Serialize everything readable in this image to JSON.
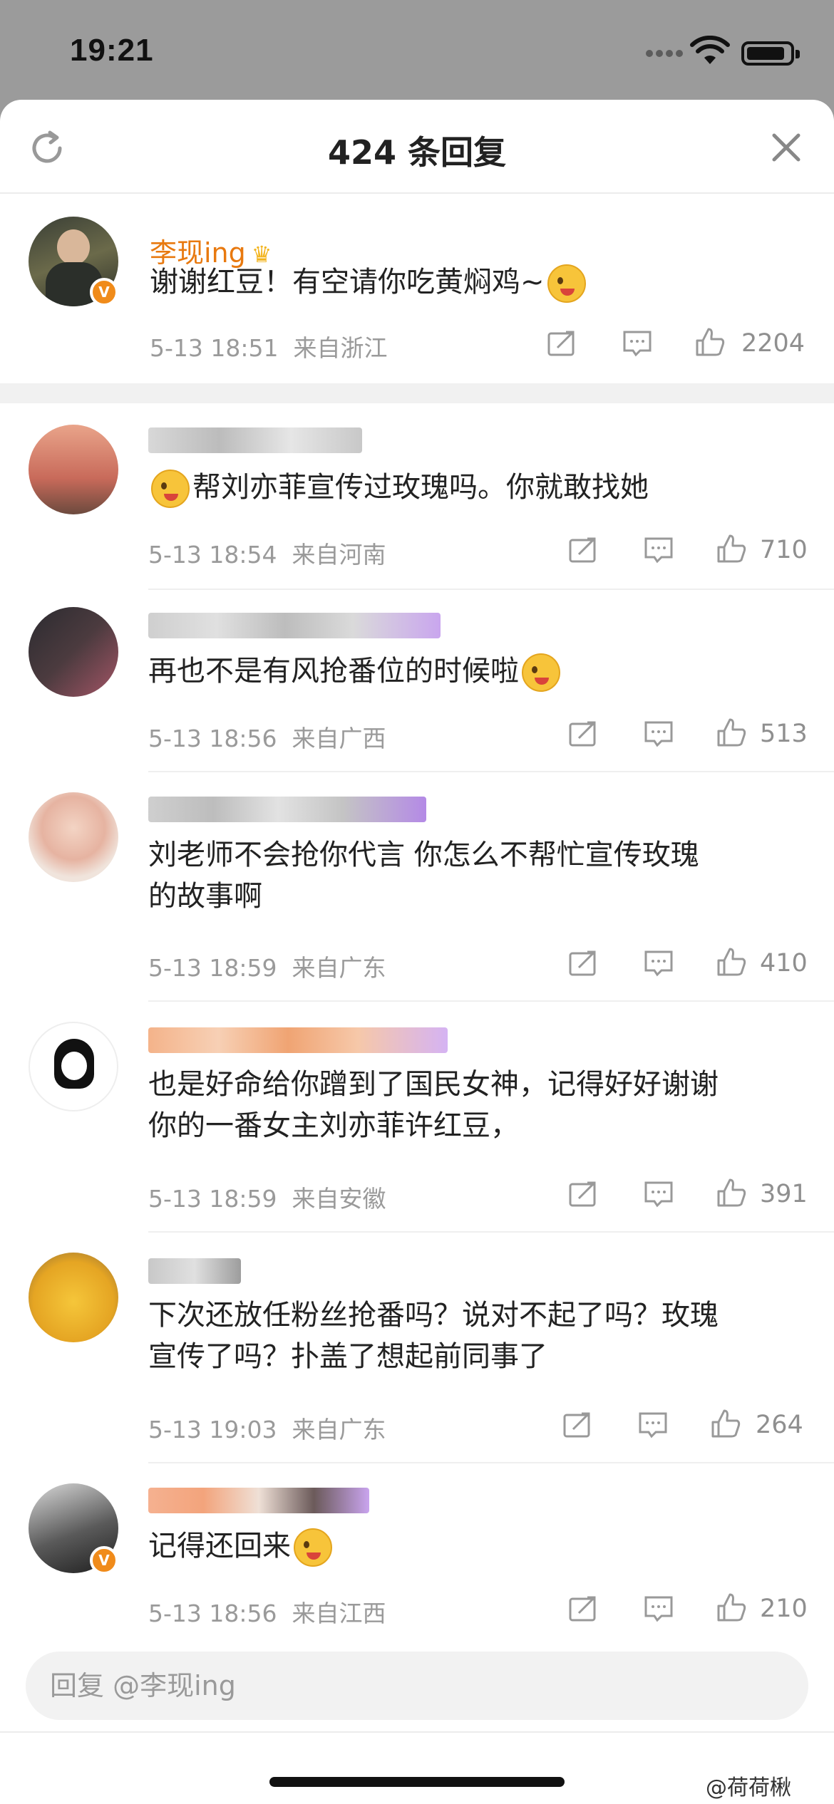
{
  "status_bar": {
    "time": "19:21"
  },
  "header": {
    "title": "424 条回复",
    "refresh_icon": "refresh-icon",
    "close_icon": "close-icon"
  },
  "top_comment": {
    "username": "李现ing",
    "badge": "crown",
    "text": "谢谢红豆！有空请你吃黄焖鸡~",
    "time": "5-13 18:51",
    "location": "来自浙江",
    "likes": "2204",
    "verified_badge": "V"
  },
  "replies": [
    {
      "text": "帮刘亦菲宣传过玫瑰吗。你就敢找她",
      "time": "5-13 18:54",
      "location": "来自河南",
      "likes": "710",
      "leading_emoji": true
    },
    {
      "text": "再也不是有风抢番位的时候啦",
      "time": "5-13 18:56",
      "location": "来自广西",
      "likes": "513",
      "trailing_emoji": true
    },
    {
      "text_line1": "刘老师不会抢你代言 你怎么不帮忙宣传玫瑰",
      "text_line2": "的故事啊",
      "time": "5-13 18:59",
      "location": "来自广东",
      "likes": "410"
    },
    {
      "text_line1": "也是好命给你蹭到了国民女神，记得好好谢谢",
      "text_line2": "你的一番女主刘亦菲许红豆，",
      "time": "5-13 18:59",
      "location": "来自安徽",
      "likes": "391"
    },
    {
      "text_line1": "下次还放任粉丝抢番吗？说对不起了吗？玫瑰",
      "text_line2": "宣传了吗？扑盖了想起前同事了",
      "time": "5-13 19:03",
      "location": "来自广东",
      "likes": "264"
    },
    {
      "text": "记得还回来",
      "time": "5-13 18:56",
      "location": "来自江西",
      "likes": "210",
      "trailing_emoji": true,
      "verified_badge": "V"
    }
  ],
  "reply_input": {
    "placeholder": "回复 @李现ing"
  },
  "watermark": "@荷荷楸",
  "colors": {
    "accent": "#e8790f",
    "meta": "#9a9a9a",
    "badge": "#f08b1a"
  }
}
